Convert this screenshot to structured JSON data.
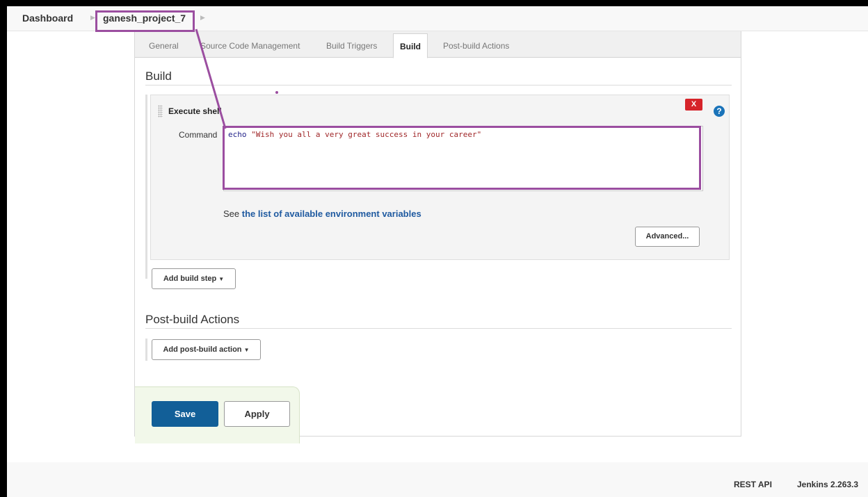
{
  "breadcrumb": {
    "dashboard": "Dashboard",
    "project": "ganesh_project_7"
  },
  "tabs": [
    {
      "label": "General"
    },
    {
      "label": "Source Code Management"
    },
    {
      "label": "Build Triggers"
    },
    {
      "label": "Build"
    },
    {
      "label": "Post-build Actions"
    }
  ],
  "active_tab": "Build",
  "build_section": {
    "title": "Build",
    "step": {
      "title": "Execute shell",
      "delete_label": "X",
      "help_label": "?",
      "command_label": "Command",
      "command_keyword": "echo",
      "command_string": "\"Wish you all a very great success in your career\"",
      "env_prefix": "See",
      "env_link": "the list of available environment variables",
      "advanced_label": "Advanced..."
    },
    "add_step_label": "Add build step"
  },
  "post_build_section": {
    "title": "Post-build Actions",
    "add_action_label": "Add post-build action"
  },
  "actions": {
    "save_label": "Save",
    "apply_label": "Apply"
  },
  "footer": {
    "rest_api": "REST API",
    "version": "Jenkins 2.263.3"
  },
  "colors": {
    "annotation": "#9b4ea0",
    "save_button": "#125f98",
    "delete_button": "#d6242a",
    "link": "#1f5aa0"
  }
}
